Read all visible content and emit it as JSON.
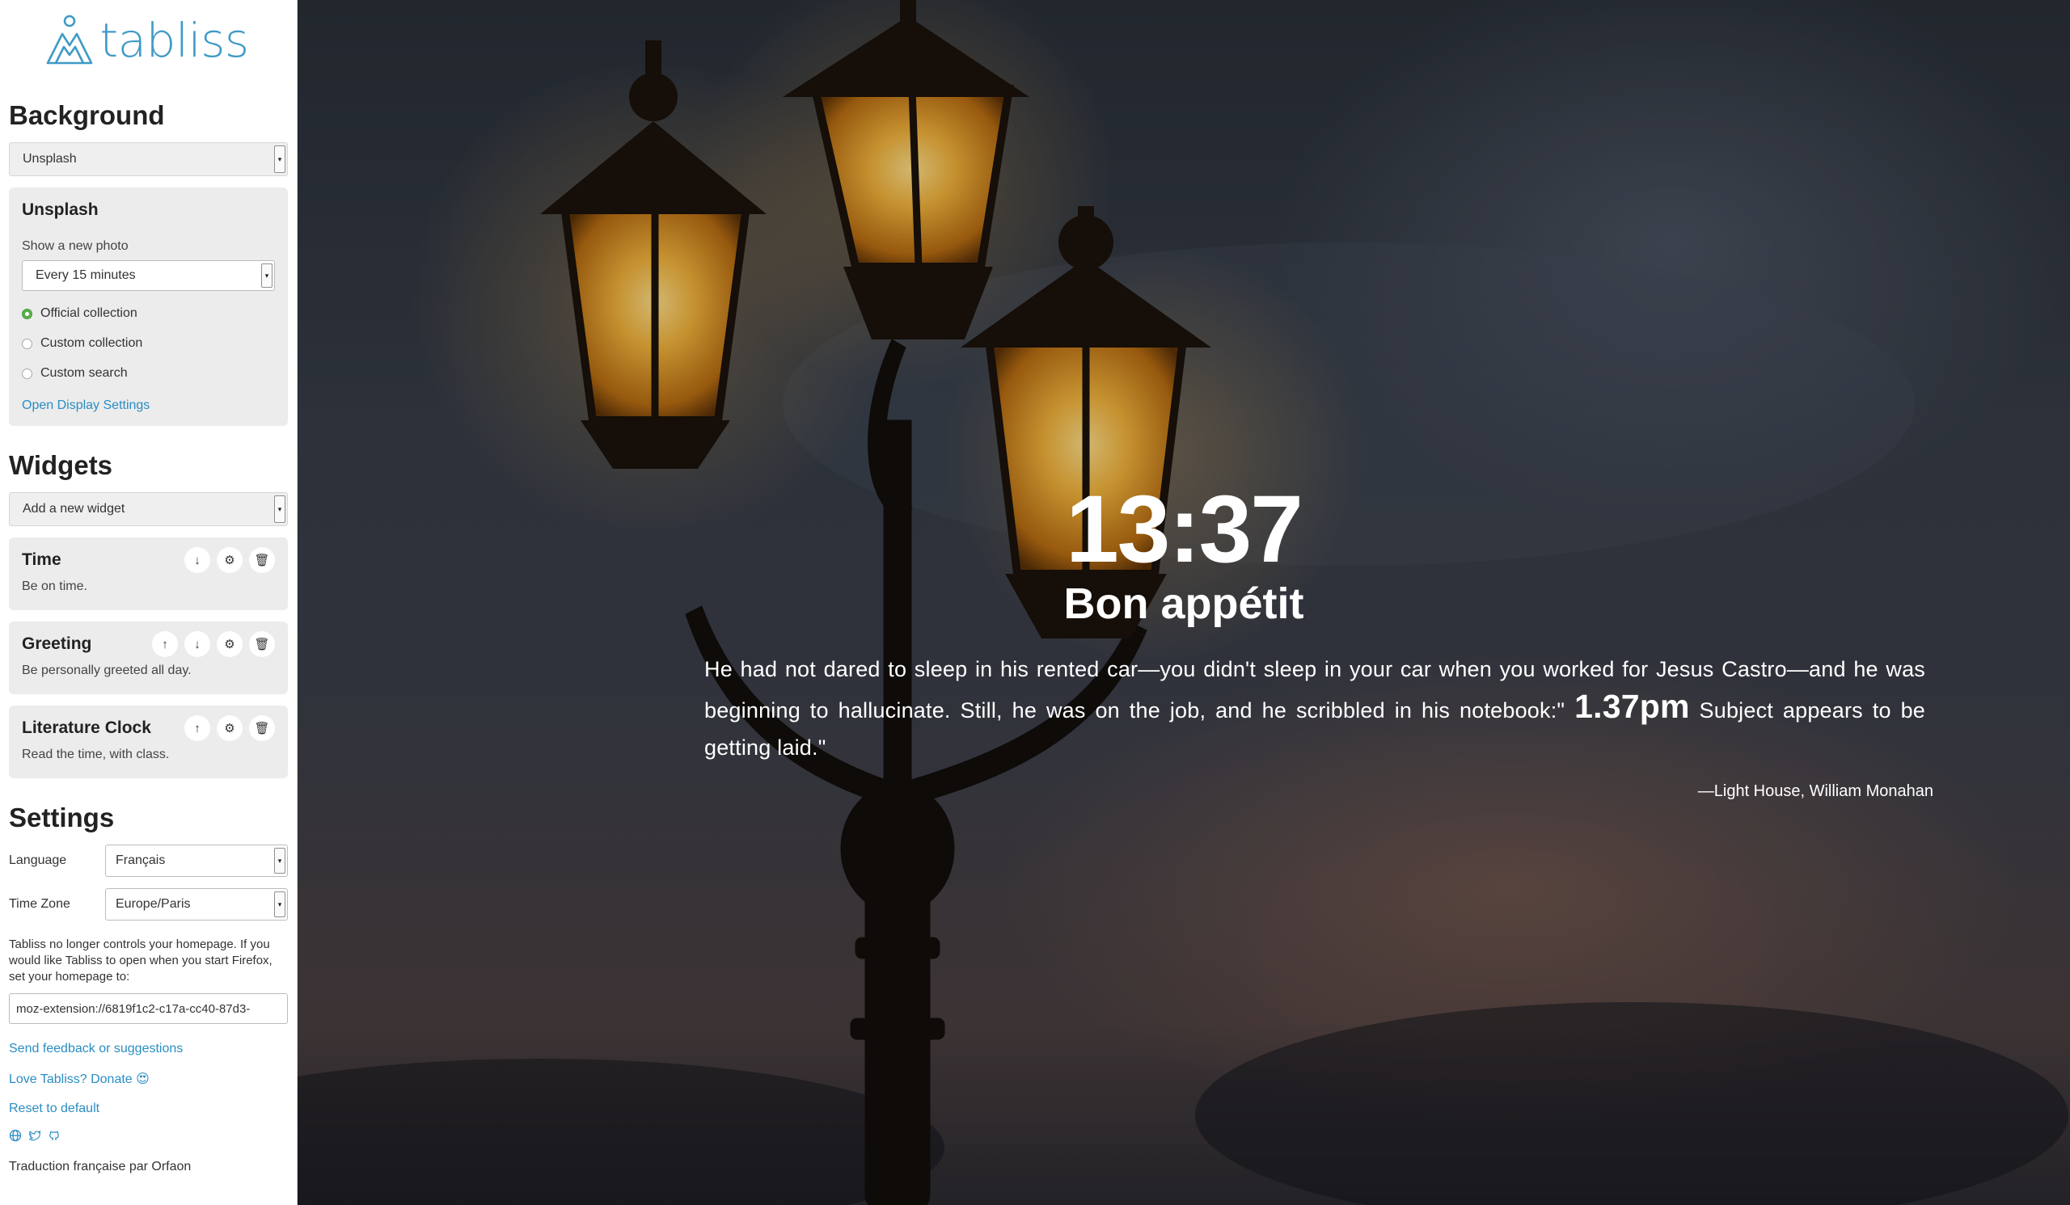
{
  "sidebar": {
    "logo_text": "tabliss",
    "background": {
      "heading": "Background",
      "source_selected": "Unsplash",
      "panel": {
        "title": "Unsplash",
        "frequency_label": "Show a new photo",
        "frequency_selected": "Every 15 minutes",
        "options": [
          {
            "label": "Official collection",
            "checked": true
          },
          {
            "label": "Custom collection",
            "checked": false
          },
          {
            "label": "Custom search",
            "checked": false
          }
        ],
        "display_settings_link": "Open Display Settings"
      }
    },
    "widgets": {
      "heading": "Widgets",
      "add_placeholder": "Add a new widget",
      "items": [
        {
          "name": "Time",
          "description": "Be on time."
        },
        {
          "name": "Greeting",
          "description": "Be personally greeted all day."
        },
        {
          "name": "Literature Clock",
          "description": "Read the time, with class."
        }
      ]
    },
    "settings": {
      "heading": "Settings",
      "language_label": "Language",
      "language_value": "Français",
      "timezone_label": "Time Zone",
      "timezone_value": "Europe/Paris",
      "homepage_note": "Tabliss no longer controls your homepage. If you would like Tabliss to open when you start Firefox, set your homepage to:",
      "homepage_url": "moz-extension://6819f1c2-c17a-cc40-87d3-",
      "feedback_link": "Send feedback or suggestions",
      "donate_link": "Love Tabliss? Donate 😍",
      "reset_link": "Reset to default",
      "social_icons": [
        "globe-icon",
        "twitter-icon",
        "github-icon"
      ],
      "credit": "Traduction française par Orfaon"
    }
  },
  "dashboard": {
    "time": "13:37",
    "greeting": "Bon appétit",
    "quote": {
      "before": "He had not dared to sleep in his rented car—you didn't sleep in your car when you worked for Jesus Castro—and he was beginning to hallucinate. Still, he was on the job, and he scribbled in his notebook:\"",
      "time": "1.37pm",
      "after": "Subject appears to be getting laid.\"",
      "citation": "—Light House, William Monahan"
    }
  }
}
